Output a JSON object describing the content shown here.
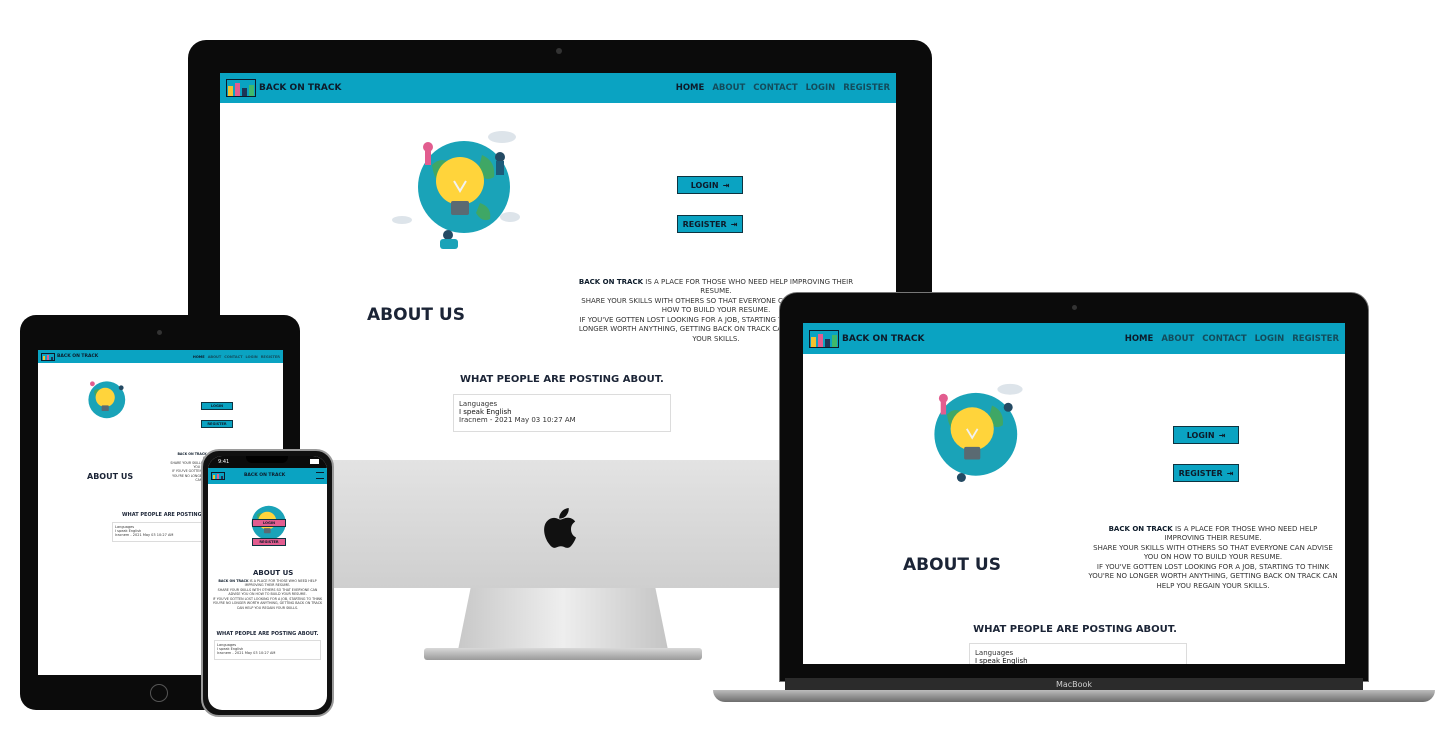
{
  "site": {
    "brand": "BACK ON TRACK",
    "nav": [
      "HOME",
      "ABOUT",
      "CONTACT",
      "LOGIN",
      "REGISTER"
    ],
    "login_button": "LOGIN",
    "register_button": "REGISTER",
    "button_icon": "sign-in-icon",
    "about_title": "ABOUT US",
    "about_brand": "BACK ON TRACK",
    "about_rest": " IS A PLACE FOR THOSE WHO NEED HELP IMPROVING THEIR RESUME.",
    "about_line2": "SHARE YOUR SKILLS WITH OTHERS SO THAT EVERYONE CAN ADVISE YOU ON HOW TO BUILD YOUR RESUME.",
    "about_line3": "IF YOU'VE GOTTEN LOST LOOKING FOR A JOB, STARTING TO THINK YOU'RE NO LONGER WORTH ANYTHING, GETTING BACK ON TRACK CAN HELP YOU REGAIN YOUR SKILLS.",
    "posts_title": "WHAT PEOPLE ARE POSTING ABOUT.",
    "post": {
      "category": "Languages",
      "text": "I speak English",
      "meta": "Iracnem - 2021 May 03 10:27 AM"
    }
  },
  "phone": {
    "time": "9:41"
  },
  "laptop": {
    "label": "MacBook"
  },
  "colors": {
    "accent": "#0aa3c2",
    "dark": "#0d1b2a",
    "device_frame": "#111111"
  }
}
